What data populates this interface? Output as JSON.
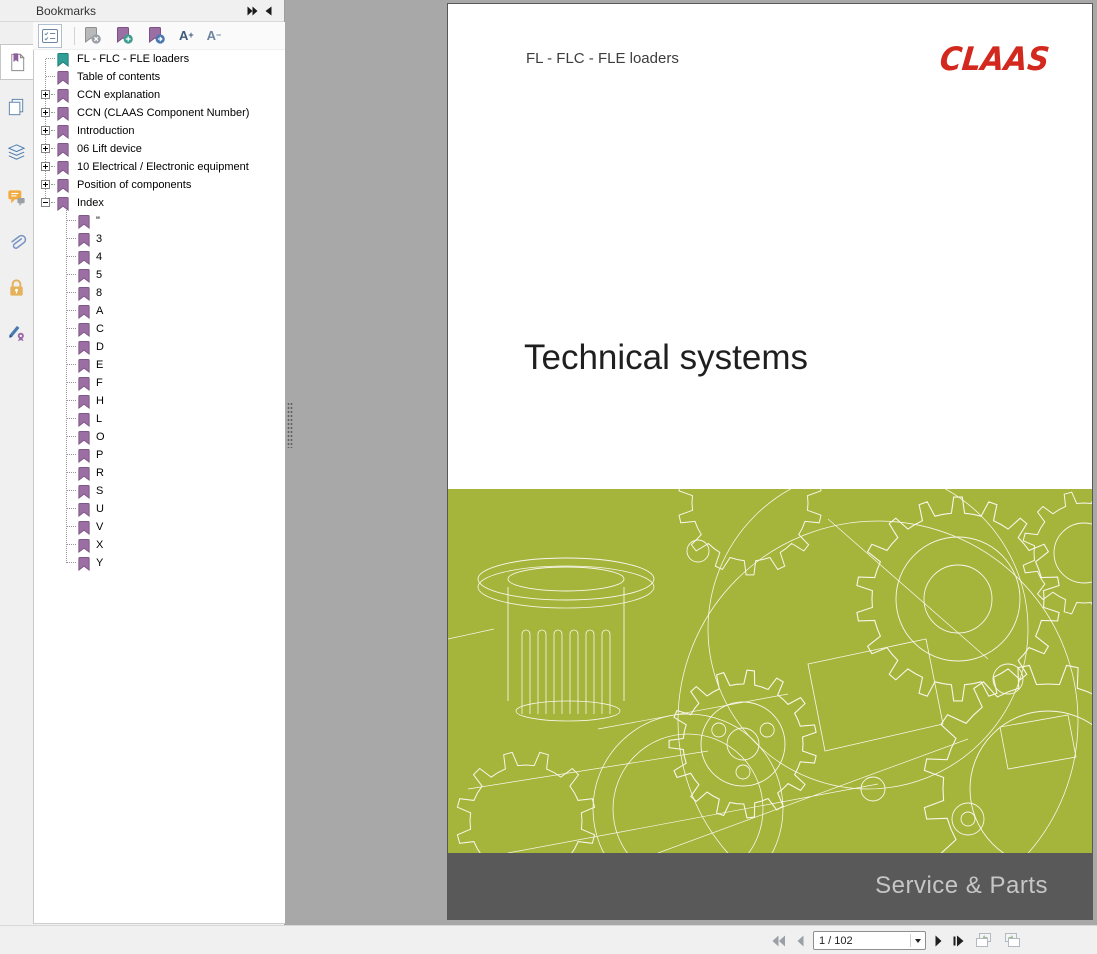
{
  "panel": {
    "title": "Bookmarks",
    "toolbar": {
      "font_increase": "A",
      "font_increase_sign": "+",
      "font_decrease": "A",
      "font_decrease_sign": "−"
    }
  },
  "sidebar_tabs": [
    "bookmarks",
    "pages",
    "layers",
    "comments",
    "attachments",
    "security",
    "signatures"
  ],
  "bookmarks": [
    {
      "label": "FL - FLC - FLE loaders",
      "level": 0,
      "expander": "none",
      "flag": "teal"
    },
    {
      "label": "Table of contents",
      "level": 0,
      "expander": "none",
      "flag": "purple"
    },
    {
      "label": "CCN explanation",
      "level": 0,
      "expander": "plus",
      "flag": "purple"
    },
    {
      "label": "CCN (CLAAS Component Number)",
      "level": 0,
      "expander": "plus",
      "flag": "purple"
    },
    {
      "label": "Introduction",
      "level": 0,
      "expander": "plus",
      "flag": "purple"
    },
    {
      "label": "06 Lift device",
      "level": 0,
      "expander": "plus",
      "flag": "purple"
    },
    {
      "label": "10 Electrical / Electronic equipment",
      "level": 0,
      "expander": "plus",
      "flag": "purple"
    },
    {
      "label": "Position of components",
      "level": 0,
      "expander": "plus",
      "flag": "purple"
    },
    {
      "label": "Index",
      "level": 0,
      "expander": "minus",
      "flag": "purple"
    },
    {
      "label": "\"",
      "level": 1,
      "expander": "none",
      "flag": "purple"
    },
    {
      "label": "3",
      "level": 1,
      "expander": "none",
      "flag": "purple"
    },
    {
      "label": "4",
      "level": 1,
      "expander": "none",
      "flag": "purple"
    },
    {
      "label": "5",
      "level": 1,
      "expander": "none",
      "flag": "purple"
    },
    {
      "label": "8",
      "level": 1,
      "expander": "none",
      "flag": "purple"
    },
    {
      "label": "A",
      "level": 1,
      "expander": "none",
      "flag": "purple"
    },
    {
      "label": "C",
      "level": 1,
      "expander": "none",
      "flag": "purple"
    },
    {
      "label": "D",
      "level": 1,
      "expander": "none",
      "flag": "purple"
    },
    {
      "label": "E",
      "level": 1,
      "expander": "none",
      "flag": "purple"
    },
    {
      "label": "F",
      "level": 1,
      "expander": "none",
      "flag": "purple"
    },
    {
      "label": "H",
      "level": 1,
      "expander": "none",
      "flag": "purple"
    },
    {
      "label": "L",
      "level": 1,
      "expander": "none",
      "flag": "purple"
    },
    {
      "label": "O",
      "level": 1,
      "expander": "none",
      "flag": "purple"
    },
    {
      "label": "P",
      "level": 1,
      "expander": "none",
      "flag": "purple"
    },
    {
      "label": "R",
      "level": 1,
      "expander": "none",
      "flag": "purple"
    },
    {
      "label": "S",
      "level": 1,
      "expander": "none",
      "flag": "purple"
    },
    {
      "label": "U",
      "level": 1,
      "expander": "none",
      "flag": "purple"
    },
    {
      "label": "V",
      "level": 1,
      "expander": "none",
      "flag": "purple"
    },
    {
      "label": "X",
      "level": 1,
      "expander": "none",
      "flag": "purple"
    },
    {
      "label": "Y",
      "level": 1,
      "expander": "none",
      "flag": "purple"
    }
  ],
  "document": {
    "header_title": "FL - FLC - FLE loaders",
    "logo": "CLAAS",
    "title": "Technical systems",
    "footer": "Service & Parts"
  },
  "pager": {
    "value": "1 / 102"
  },
  "colors": {
    "cover_green": "#a5b43a",
    "band_dark": "#595959",
    "claas_red": "#d2281e",
    "flag_purple": "#9c6fa4",
    "flag_teal": "#2f9e97"
  }
}
